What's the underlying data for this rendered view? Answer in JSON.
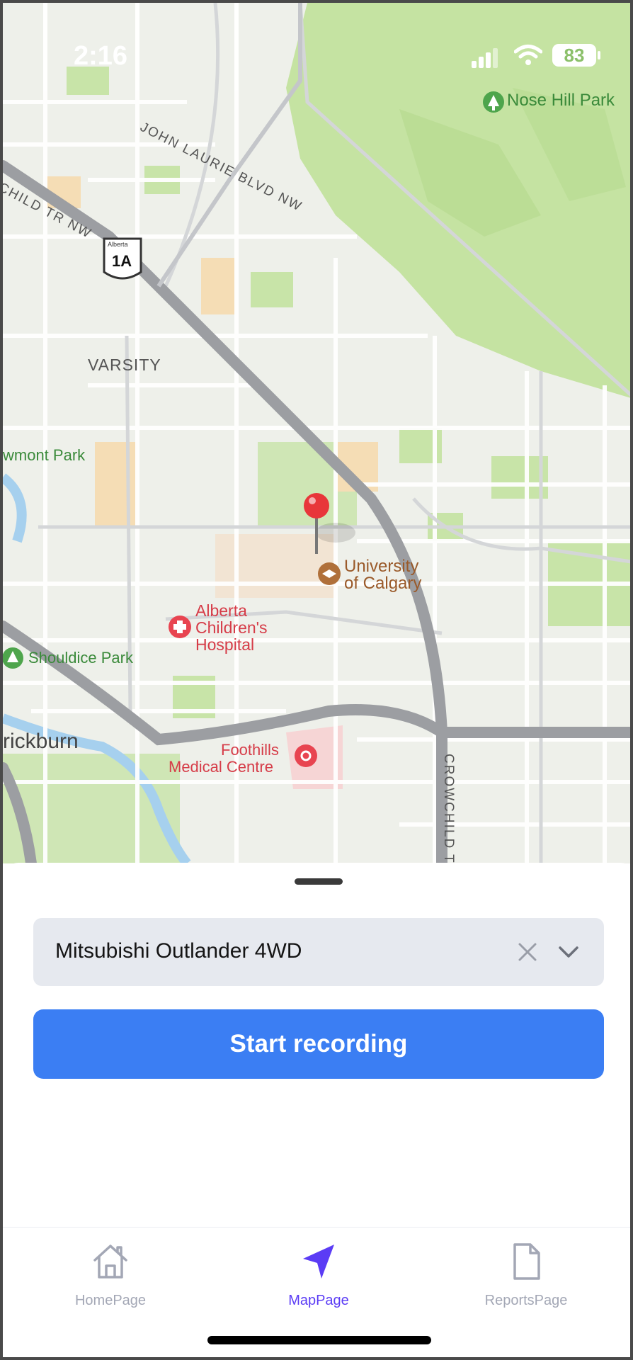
{
  "status_bar": {
    "time": "2:16",
    "battery": "83"
  },
  "map": {
    "labels": {
      "nose_hill_park": "Nose Hill Park",
      "john_laurie": "JOHN LAURIE BLVD NW",
      "crowchild_nw": "CHILD TR NW",
      "highway_shield": "1A",
      "highway_province": "Alberta",
      "varsity": "VARSITY",
      "bowmont_park": "wmont Park",
      "university_line1": "University",
      "university_line2": "of Calgary",
      "childrens_line1": "Alberta",
      "childrens_line2": "Children's",
      "childrens_line3": "Hospital",
      "shouldice_park": "Shouldice Park",
      "brickburn": "rickburn",
      "foothills_line1": "Foothills",
      "foothills_line2": "Medical Centre",
      "crowchild_vertical": "CROWCHILD T"
    }
  },
  "vehicle_select": {
    "value": "Mitsubishi Outlander 4WD"
  },
  "record_button": {
    "label": "Start recording"
  },
  "tabs": [
    {
      "label": "HomePage",
      "icon": "home-icon",
      "active": false
    },
    {
      "label": "MapPage",
      "icon": "navigation-arrow-icon",
      "active": true
    },
    {
      "label": "ReportsPage",
      "icon": "document-icon",
      "active": false
    }
  ],
  "colors": {
    "accent": "#3b7ef3",
    "active_tab": "#5b3cf5",
    "inactive_tab": "#a3a7b5",
    "park_green": "#c4e3a0",
    "pin_red": "#e8363a"
  }
}
